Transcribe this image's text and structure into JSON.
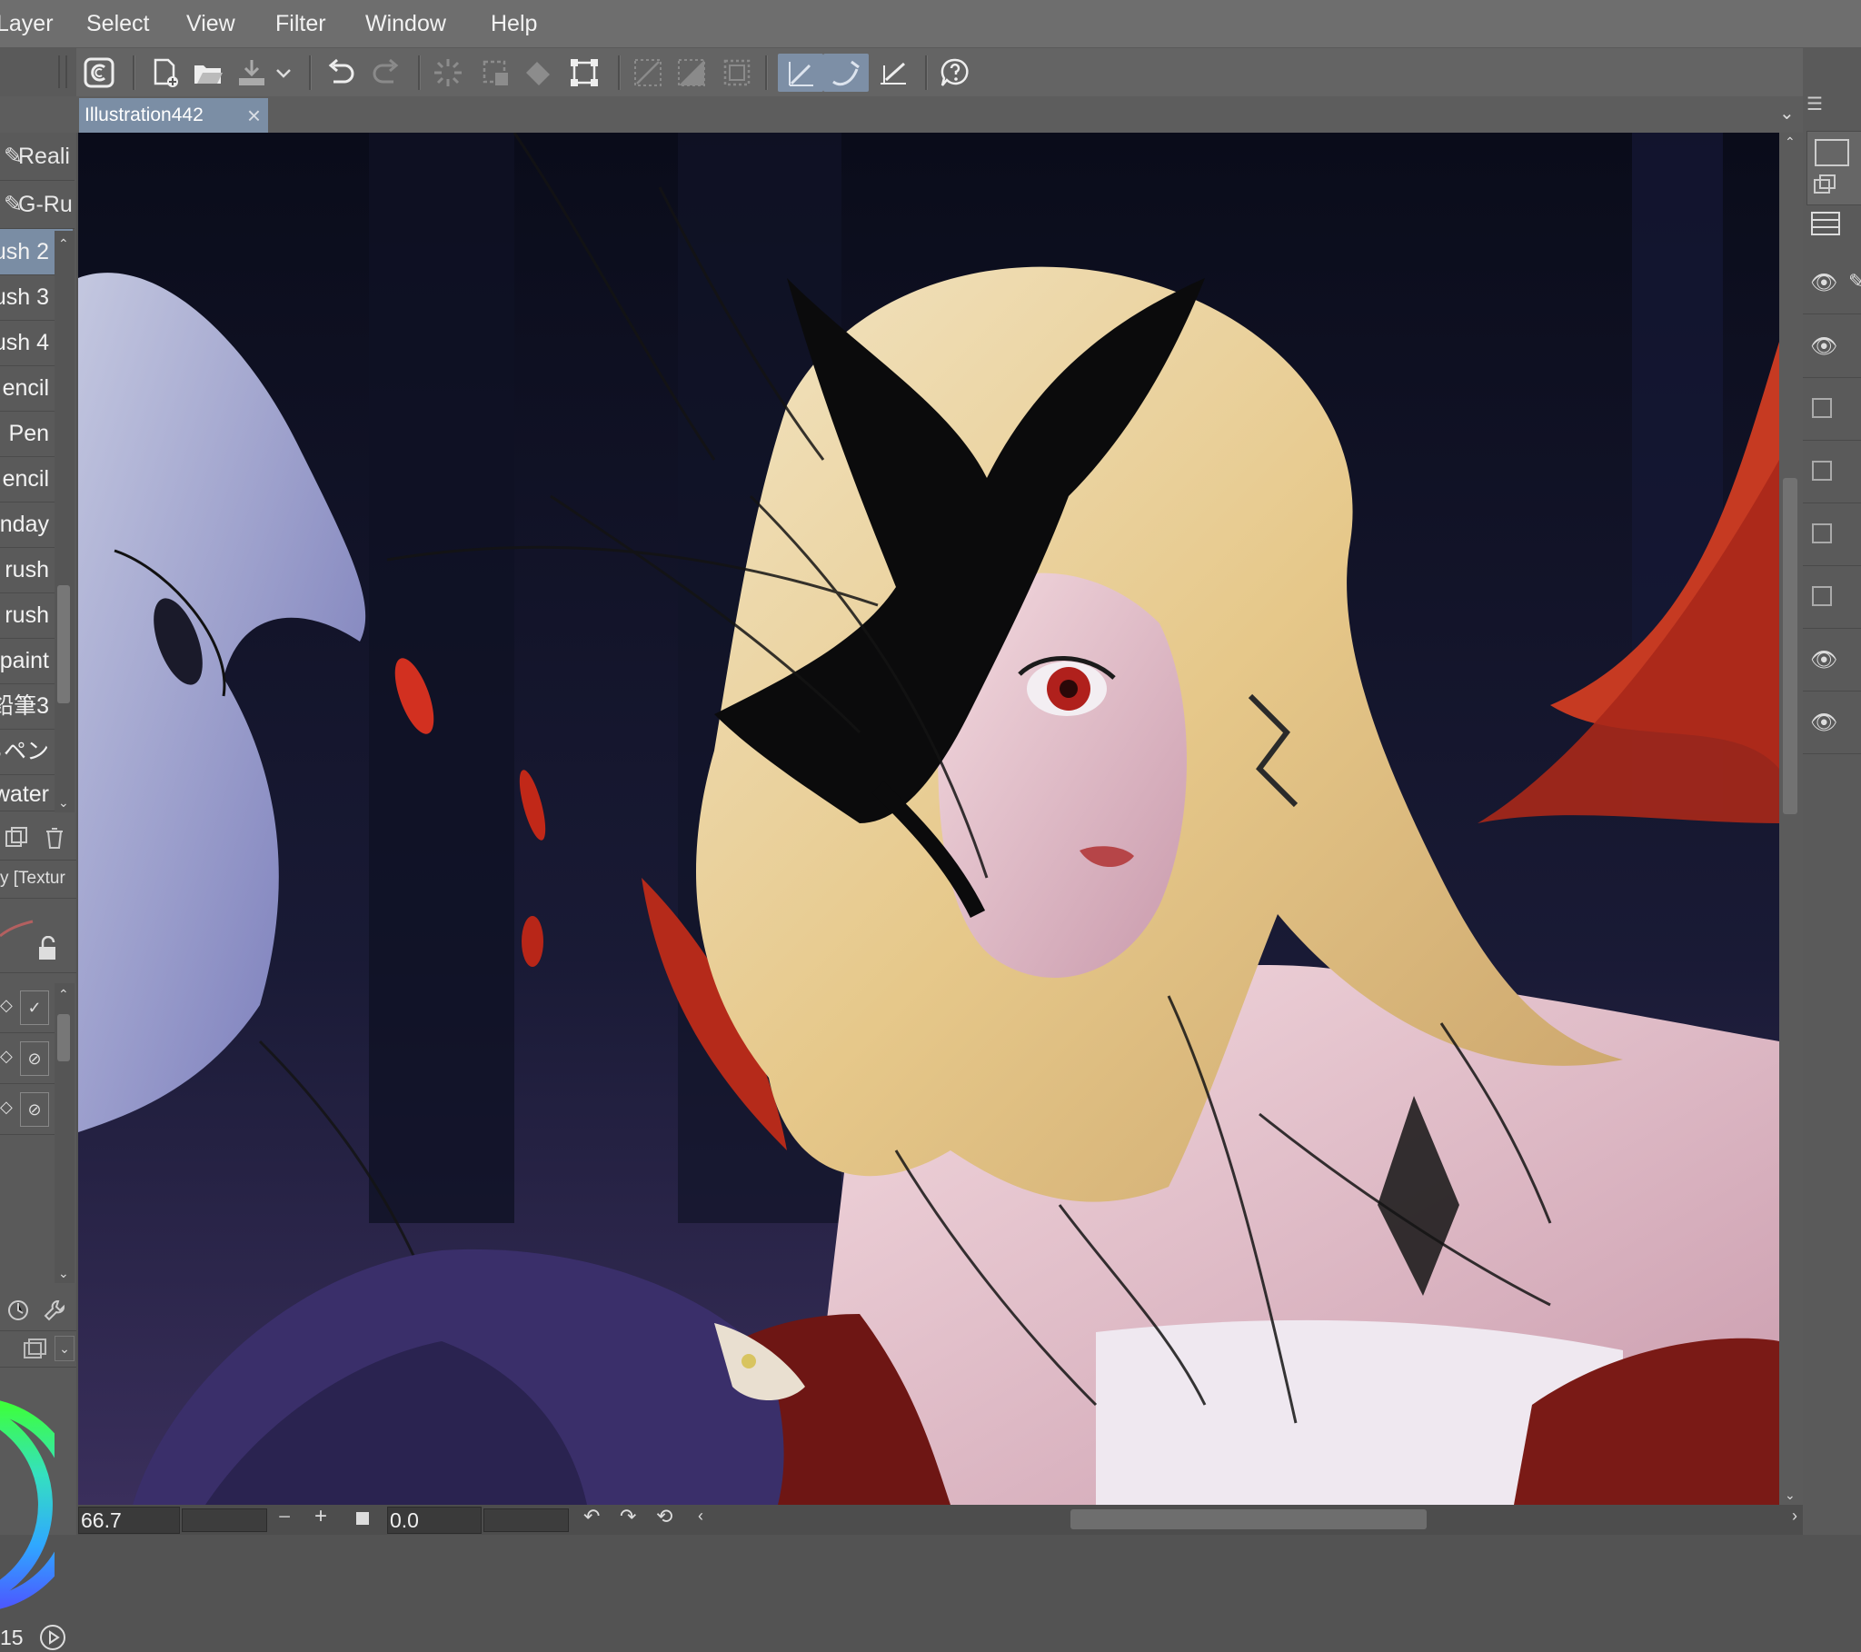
{
  "menu": {
    "items": [
      "Layer",
      "Select",
      "View",
      "Filter",
      "Window",
      "Help"
    ]
  },
  "document": {
    "tab_title": "Illustration442",
    "close_glyph": "×"
  },
  "brush_list": {
    "top_items": [
      "Reali",
      "G-Ru"
    ],
    "items": [
      "ush 2",
      "ush 3",
      "ush 4",
      "encil",
      "Pen",
      "encil",
      "nday",
      "rush",
      "rush",
      "paint",
      "鉛筆3",
      "るペン",
      "water"
    ],
    "selected_index": 0,
    "subtool_label": "y [Textur"
  },
  "status": {
    "zoom": "66.7",
    "rotation": "0.0",
    "left_value": "15"
  },
  "colors": {
    "accent": "#7b8ea5",
    "canvas_bg": "#0d0f1e"
  },
  "icons": [
    "clip-studio-logo-icon",
    "new-file-icon",
    "open-folder-icon",
    "import-icon",
    "undo-icon",
    "redo-icon",
    "clear-icon",
    "selection-icon",
    "fill-icon",
    "transform-icon",
    "ruler-snap-icon",
    "special-ruler-icon",
    "grid-icon",
    "pen-pressure-icon",
    "stabilizer-icon",
    "ruler-icon",
    "help-icon",
    "eye-icon",
    "lock-icon",
    "trash-icon",
    "duplicate-icon"
  ]
}
